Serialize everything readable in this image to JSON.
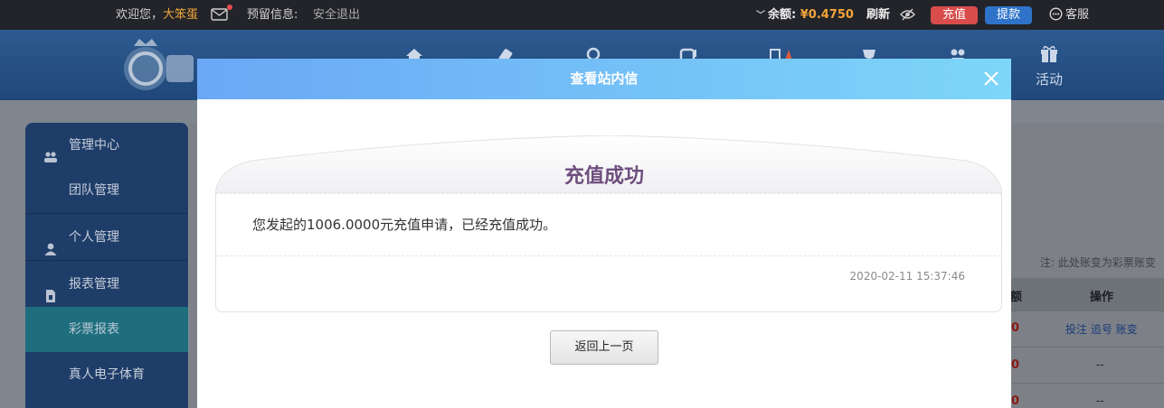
{
  "topbar": {
    "welcome_prefix": "欢迎您，",
    "username": "大笨蛋",
    "reserve_info": "预留信息:",
    "logout": "安全退出",
    "balance_label": "余额:",
    "balance_amount": "¥0.4750",
    "refresh": "刷新",
    "charge": "充值",
    "withdraw": "提款",
    "service": "客服"
  },
  "nav": {
    "activity_label": "活动"
  },
  "sidebar": {
    "items": [
      {
        "label": "管理中心",
        "icon": "users-icon"
      },
      {
        "label": "团队管理"
      },
      {
        "label": "个人管理",
        "icon": "user-icon"
      },
      {
        "label": "报表管理",
        "icon": "report-icon"
      },
      {
        "label": "彩票报表"
      },
      {
        "label": "真人电子体育"
      }
    ]
  },
  "background": {
    "note": "注: 此处账变为彩票账变",
    "col_amount_tail": "额",
    "col_ops": "操作",
    "row1_value": "0",
    "row1_ops": "投注 追号 账变",
    "row2_value": "0",
    "row2_ops": "--",
    "row3_value": "0",
    "row3_ops": "--"
  },
  "modal": {
    "title": "查看站内信",
    "message_title": "充值成功",
    "message_body": "您发起的1006.0000元充值申请，已经充值成功。",
    "timestamp": "2020-02-11 15:37:46",
    "back_button": "返回上一页"
  },
  "colors": {
    "modal_header_start": "#6aa8f6",
    "modal_header_end": "#7dd6f8",
    "message_title": "#6e4f7e",
    "charge_button": "#d84c4c",
    "withdraw_button": "#2e73c9",
    "balance_amount": "#f3a43a"
  }
}
